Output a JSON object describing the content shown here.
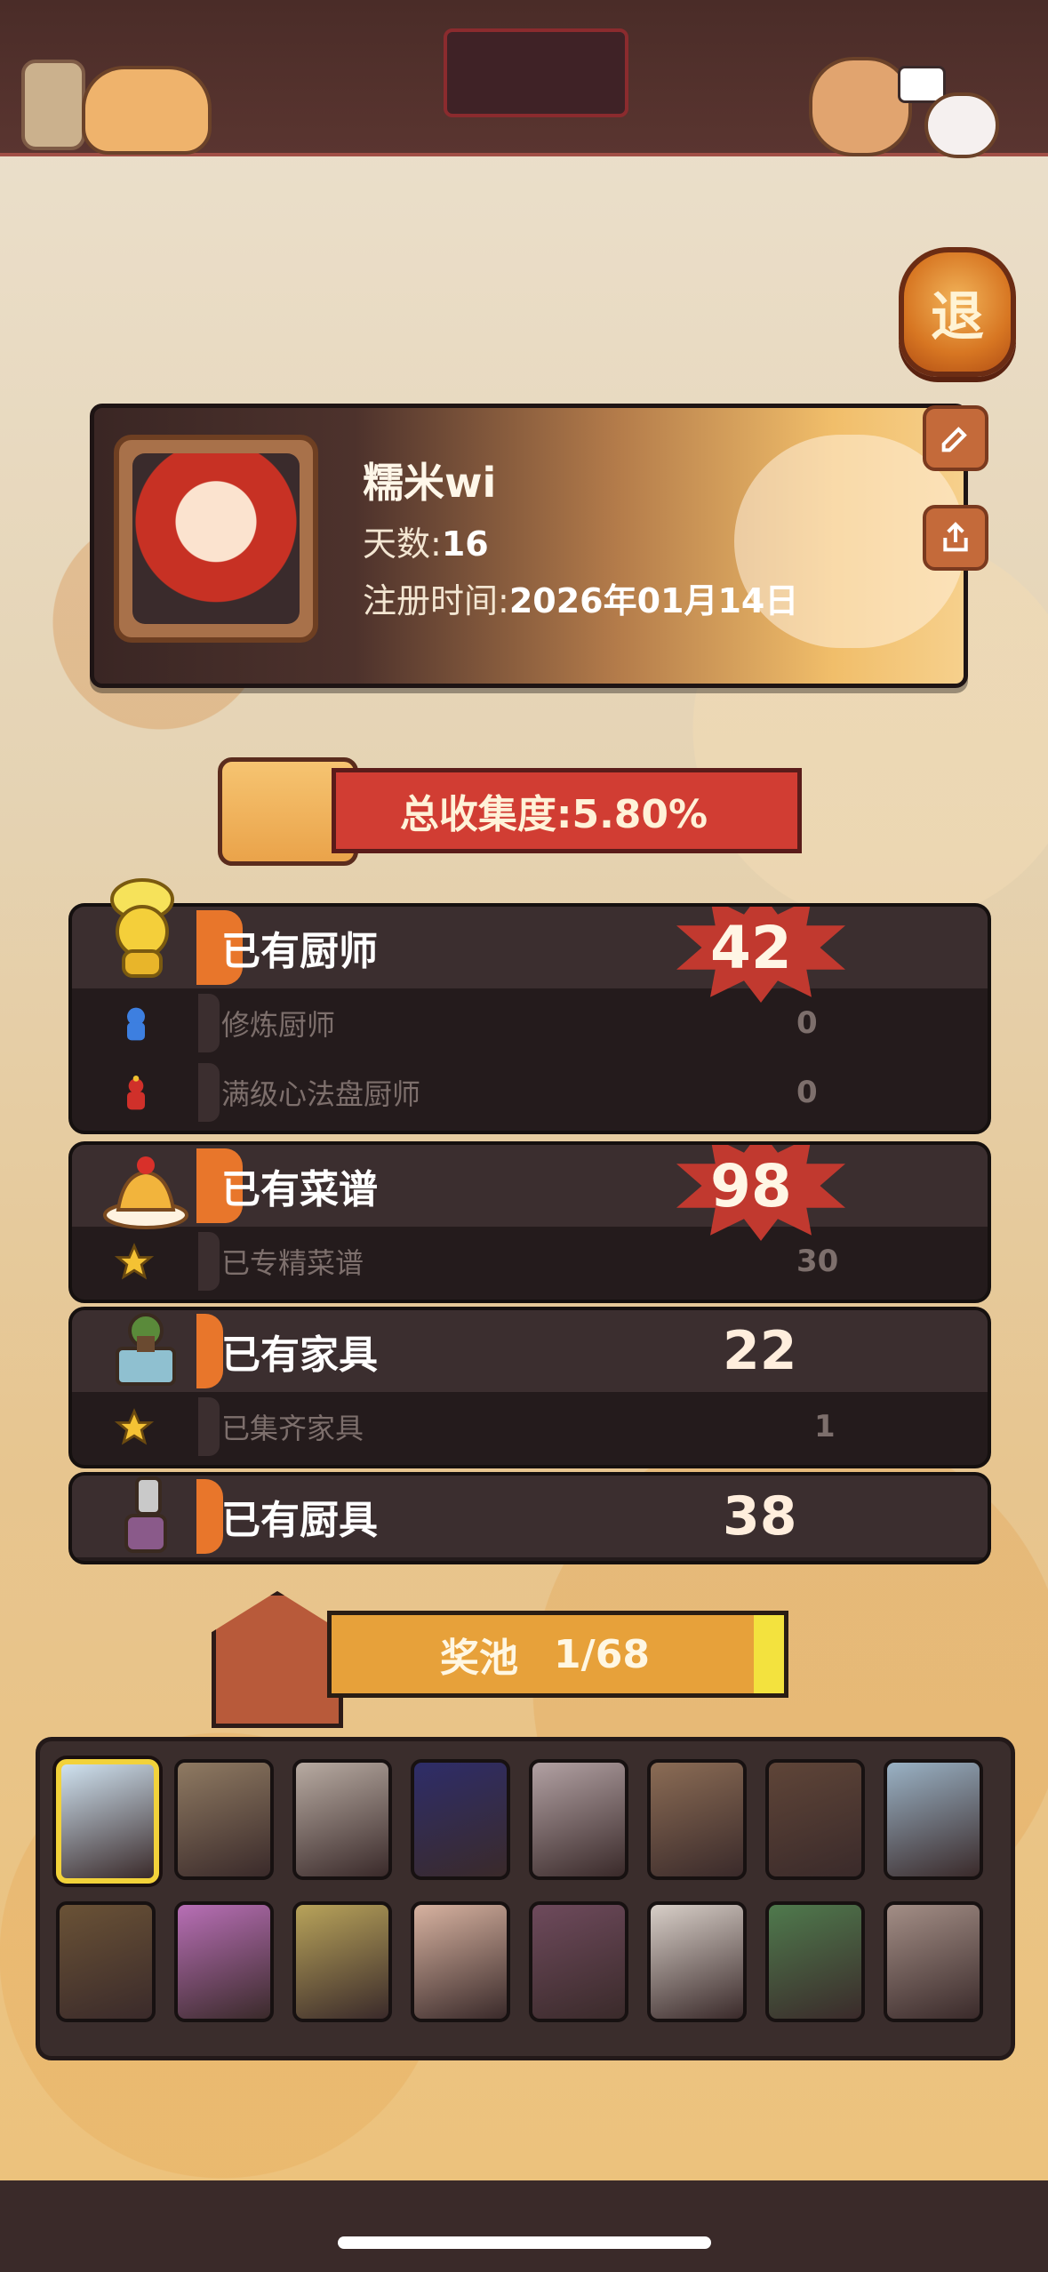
{
  "header": {},
  "exit_button": {
    "label": "退"
  },
  "profile": {
    "name": "糯米wi",
    "days_label": "天数:",
    "days_value": "16",
    "register_label": "注册时间:",
    "register_value": "2026年01月14日"
  },
  "collection": {
    "label": "总收集度:5.80%"
  },
  "stats": {
    "chefs": {
      "label": "已有厨师",
      "value": "42",
      "sub": [
        {
          "label": "修炼厨师",
          "value": "0"
        },
        {
          "label": "满级心法盘厨师",
          "value": "0"
        }
      ]
    },
    "recipes": {
      "label": "已有菜谱",
      "value": "98",
      "sub": [
        {
          "label": "已专精菜谱",
          "value": "30"
        }
      ]
    },
    "furniture": {
      "label": "已有家具",
      "value": "22",
      "sub": [
        {
          "label": "已集齐家具",
          "value": "1"
        }
      ]
    },
    "utensils": {
      "label": "已有厨具",
      "value": "38"
    }
  },
  "prize_pool": {
    "label": "奖池",
    "count": "1/68"
  },
  "pool_cards": [
    {
      "color": "#cfe2f0",
      "selected": true
    },
    {
      "color": "#8f7a62"
    },
    {
      "color": "#b8aba2"
    },
    {
      "color": "#2e2d69"
    },
    {
      "color": "#b2a1a3"
    },
    {
      "color": "#8b6c55"
    },
    {
      "color": "#5f4538"
    },
    {
      "color": "#9ab2c5"
    },
    {
      "color": "#6a5236"
    },
    {
      "color": "#b86fb6"
    },
    {
      "color": "#b8a35a"
    },
    {
      "color": "#d7b2a0"
    },
    {
      "color": "#6e4a5c"
    },
    {
      "color": "#d8cfc8"
    },
    {
      "color": "#4f7a4d"
    },
    {
      "color": "#a38e86"
    }
  ]
}
